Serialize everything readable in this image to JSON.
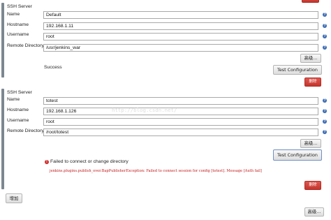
{
  "servers": [
    {
      "section_title": "SSH Server",
      "fields": [
        {
          "label": "Name",
          "value": "Default"
        },
        {
          "label": "Hostname",
          "value": "192.168.1.11"
        },
        {
          "label": "Username",
          "value": "root"
        },
        {
          "label": "Remote Directory",
          "value": "/usr/jenkins_war"
        }
      ],
      "advanced_label": "高级...",
      "status_text": "Success",
      "test_button_label": "Test Configuration",
      "delete_label": "删除"
    },
    {
      "section_title": "SSH Server",
      "fields": [
        {
          "label": "Name",
          "value": "totest"
        },
        {
          "label": "Hostname",
          "value": "192.168.1.126"
        },
        {
          "label": "Username",
          "value": "root"
        },
        {
          "label": "Remote Directory",
          "value": "/root/totest"
        }
      ],
      "advanced_label": "高级...",
      "error_title": "Failed to connect or change directory",
      "error_message": "jenkins.plugins.publish_over.BapPublisherException: Failed to connect session for config [totest]. Message [Auth fail]",
      "test_button_label": "Test Configuration",
      "delete_label": "删除"
    }
  ],
  "watermark": "http://blog.csdn.net/",
  "add_button_label": "增加",
  "bottom_advanced_label": "高级...",
  "icons": {
    "help": "help-icon",
    "error": "error-icon",
    "drag": "drag-handle-icon"
  },
  "colors": {
    "delete": "#c9382f",
    "error_text": "#c41a1a",
    "help": "#3c6cb4"
  }
}
